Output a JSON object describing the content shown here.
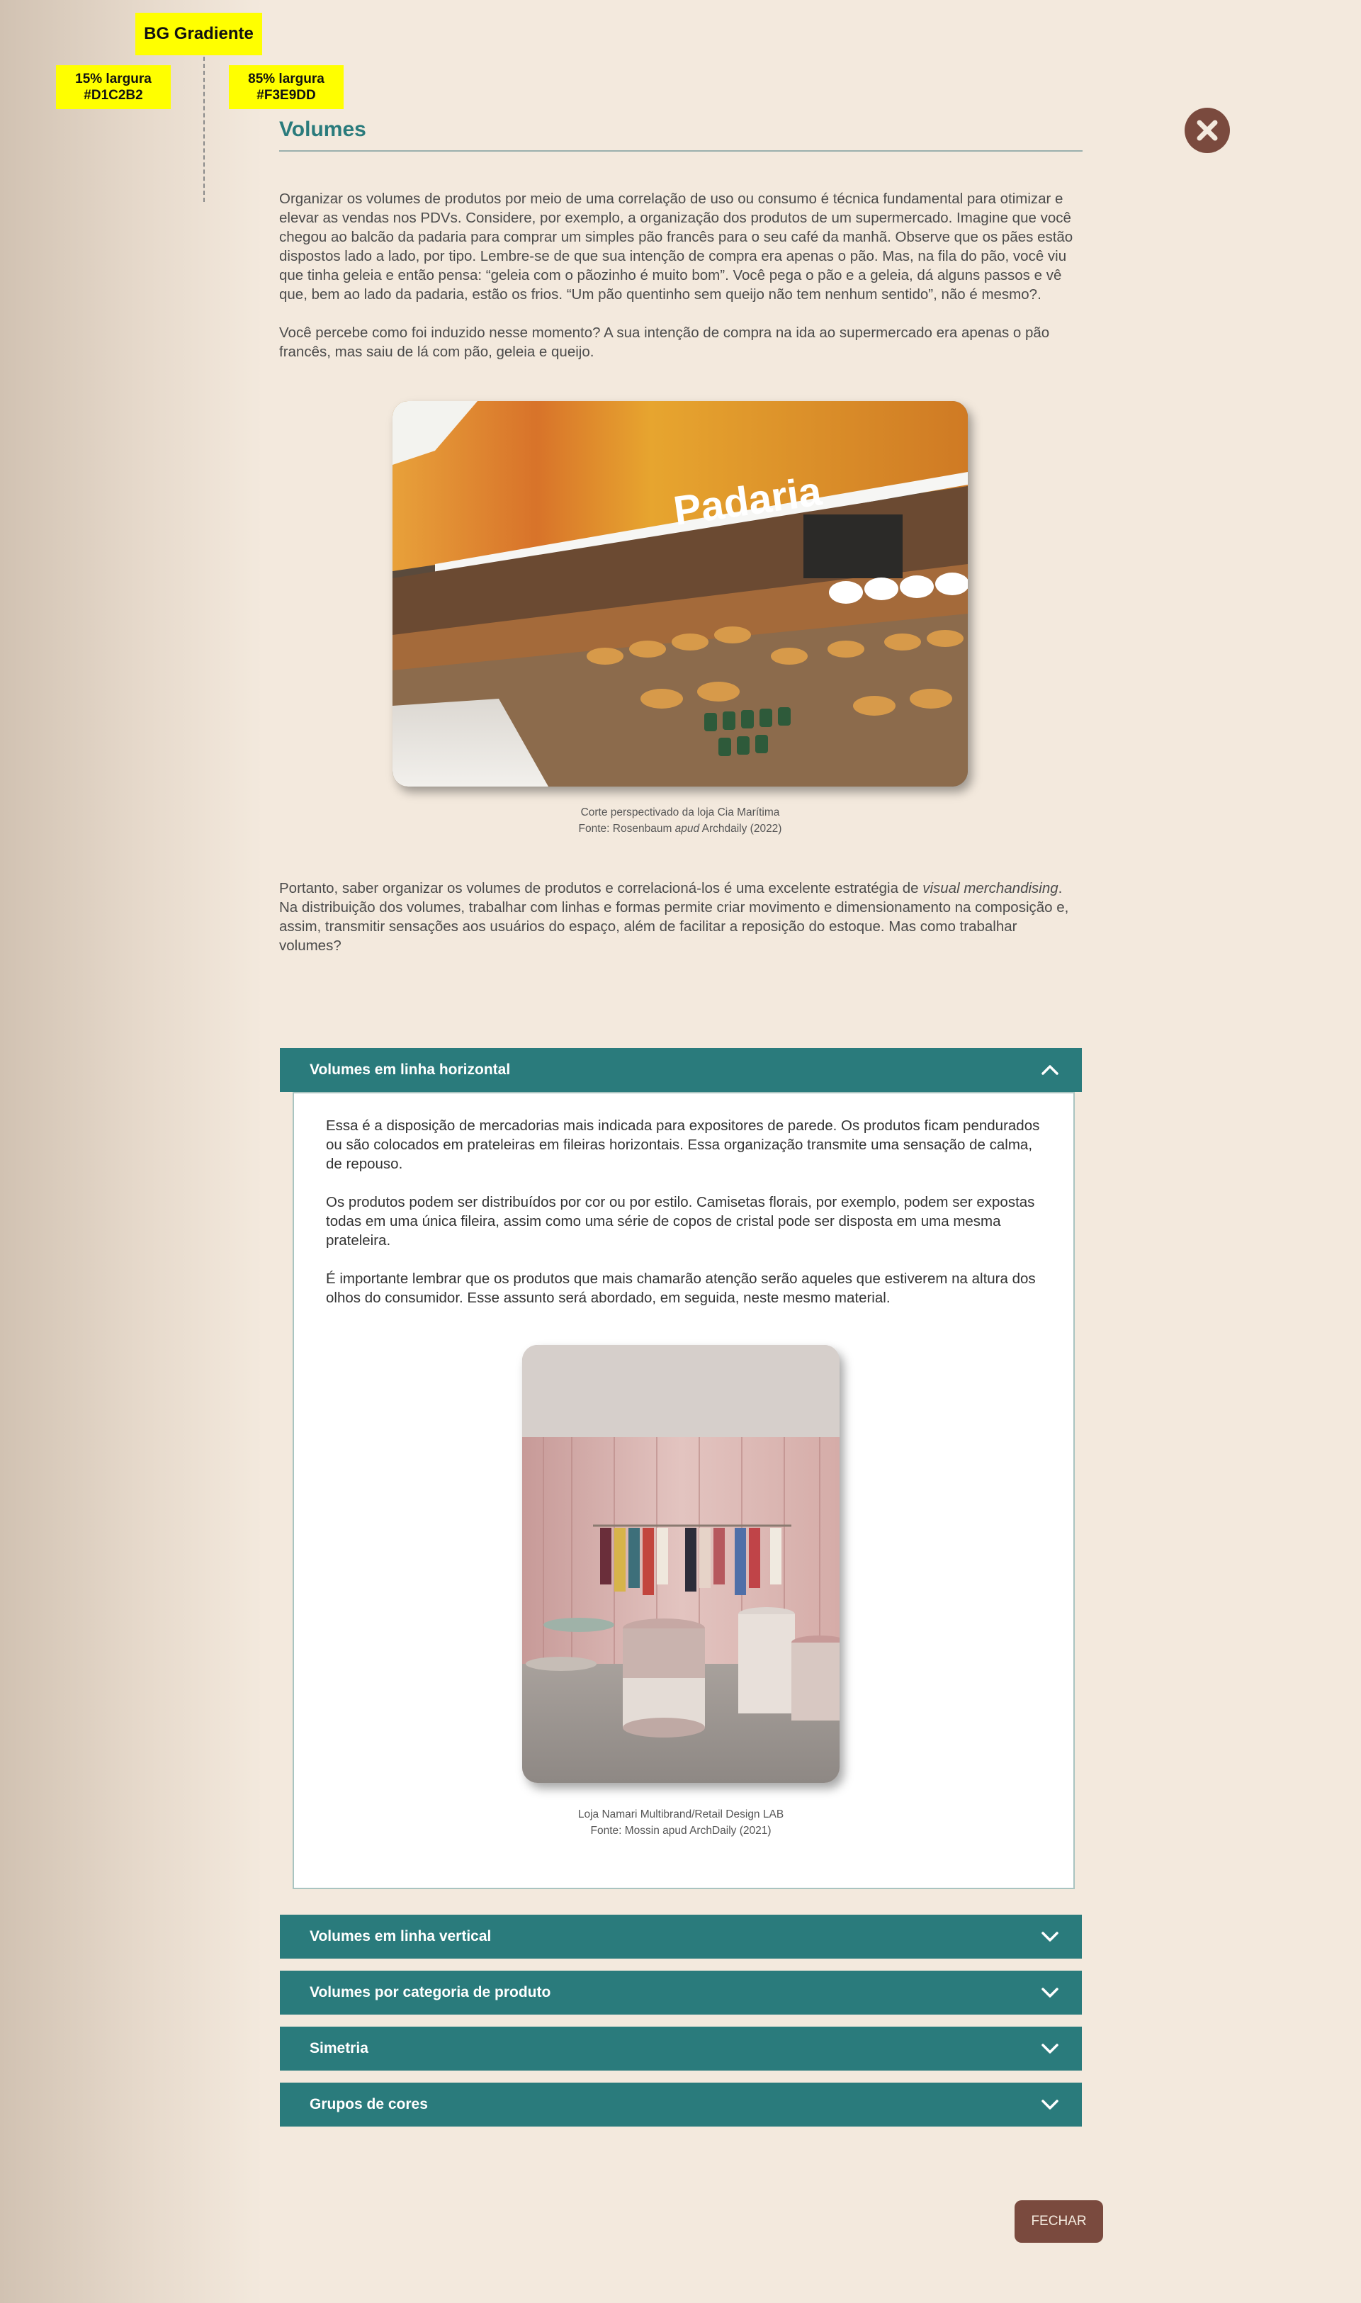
{
  "annotations": {
    "title": "BG Gradiente",
    "left_line1": "15% largura",
    "left_line2": "#D1C2B2",
    "right_line1": "85% largura",
    "right_line2": "#F3E9DD"
  },
  "colors": {
    "gradient_start": "#D1C2B2",
    "gradient_end": "#F3E9DD",
    "accent_teal": "#2A7B7C",
    "button_brown": "#7A4A3E"
  },
  "header": {
    "title": "Volumes",
    "close_icon": "close-icon"
  },
  "content": {
    "p1": "Organizar os volumes de produtos por meio de uma correlação de uso ou consumo é técnica fundamental para otimizar e elevar as vendas nos PDVs. Considere, por exemplo, a organização dos produtos de um supermercado. Imagine que você chegou ao balcão da padaria para comprar um simples pão francês para o seu café da manhã. Observe que os pães estão dispostos lado a lado, por tipo. Lembre-se de que sua intenção de compra era apenas o pão. Mas, na fila do pão, você viu que tinha geleia e então pensa: “geleia com o pãozinho é muito bom”. Você pega o pão e a geleia, dá alguns passos e vê que, bem ao lado da padaria, estão os frios. “Um pão quentinho sem queijo não tem nenhum sentido”, não é mesmo?.",
    "p2": "Você percebe como foi induzido nesse momento? A sua intenção de compra na ida ao supermercado era apenas o pão francês, mas saiu de lá com pão, geleia e queijo.",
    "image1_sign": "Padaria",
    "caption1_line1": "Corte perspectivado da loja Cia Marítima",
    "caption1_line2_a": "Fonte: Rosenbaum ",
    "caption1_line2_em": "apud",
    "caption1_line2_b": " Archdaily (2022)",
    "p3_a": "Portanto, saber organizar os volumes de produtos e correlacioná-los é uma excelente estratégia de ",
    "p3_em": "visual merchandising",
    "p3_b": ". Na distribuição dos volumes, trabalhar com linhas e formas permite criar movimento e dimensionamento na composição e, assim, transmitir sensações aos usuários do espaço, além de facilitar a reposição do estoque. Mas como trabalhar volumes?"
  },
  "accordion": {
    "items": [
      {
        "label": "Volumes em linha horizontal",
        "expanded": true
      },
      {
        "label": "Volumes em linha vertical",
        "expanded": false
      },
      {
        "label": "Volumes por categoria de produto",
        "expanded": false
      },
      {
        "label": "Simetria",
        "expanded": false
      },
      {
        "label": "Grupos de cores",
        "expanded": false
      }
    ],
    "panel": {
      "p1": "Essa é a disposição de mercadorias mais indicada para expositores de parede. Os produtos ficam pendurados ou são colocados em prateleiras em fileiras horizontais. Essa organização transmite uma sensação de calma, de repouso.",
      "p2": "Os produtos podem ser distribuídos por cor ou por estilo. Camisetas florais, por exemplo, podem ser expostas todas em uma única fileira, assim como uma série de copos de cristal pode ser disposta em uma mesma prateleira.",
      "p3": "É importante lembrar que os produtos que mais chamarão atenção serão aqueles que estiverem na altura dos olhos do consumidor. Esse assunto será abordado, em seguida, neste mesmo material.",
      "caption_line1": "Loja Namari Multibrand/Retail Design LAB",
      "caption_line2": "Fonte: Mossin apud ArchDaily (2021)"
    }
  },
  "footer": {
    "close_label": "FECHAR"
  }
}
